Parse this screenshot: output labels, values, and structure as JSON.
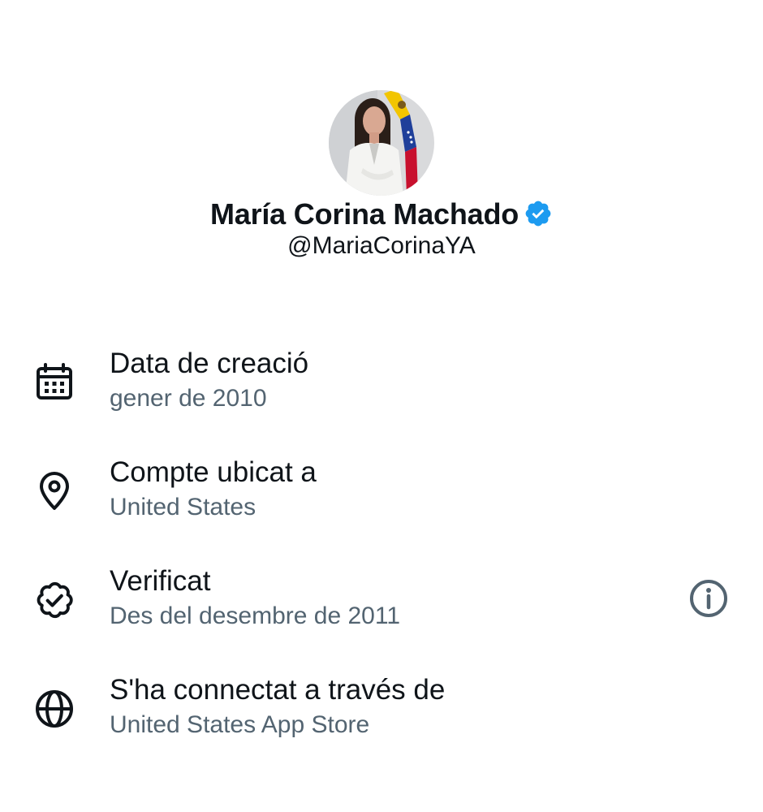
{
  "profile": {
    "display_name": "María Corina Machado",
    "handle": "@MariaCorinaYA",
    "verified": true,
    "badge_color": "#1d9bf0"
  },
  "info_items": [
    {
      "icon": "calendar-icon",
      "title": "Data de creació",
      "subtitle": "gener de 2010"
    },
    {
      "icon": "location-pin-icon",
      "title": "Compte ubicat a",
      "subtitle": "United States"
    },
    {
      "icon": "verified-badge-outline-icon",
      "title": "Verificat",
      "subtitle": "Des del desembre de 2011",
      "action_icon": "info-icon"
    },
    {
      "icon": "globe-icon",
      "title": "S'ha connectat a través de",
      "subtitle": "United States App Store"
    }
  ],
  "colors": {
    "text_primary": "#0f1419",
    "text_secondary": "#536471",
    "icon": "#0f1419",
    "background": "#ffffff"
  }
}
